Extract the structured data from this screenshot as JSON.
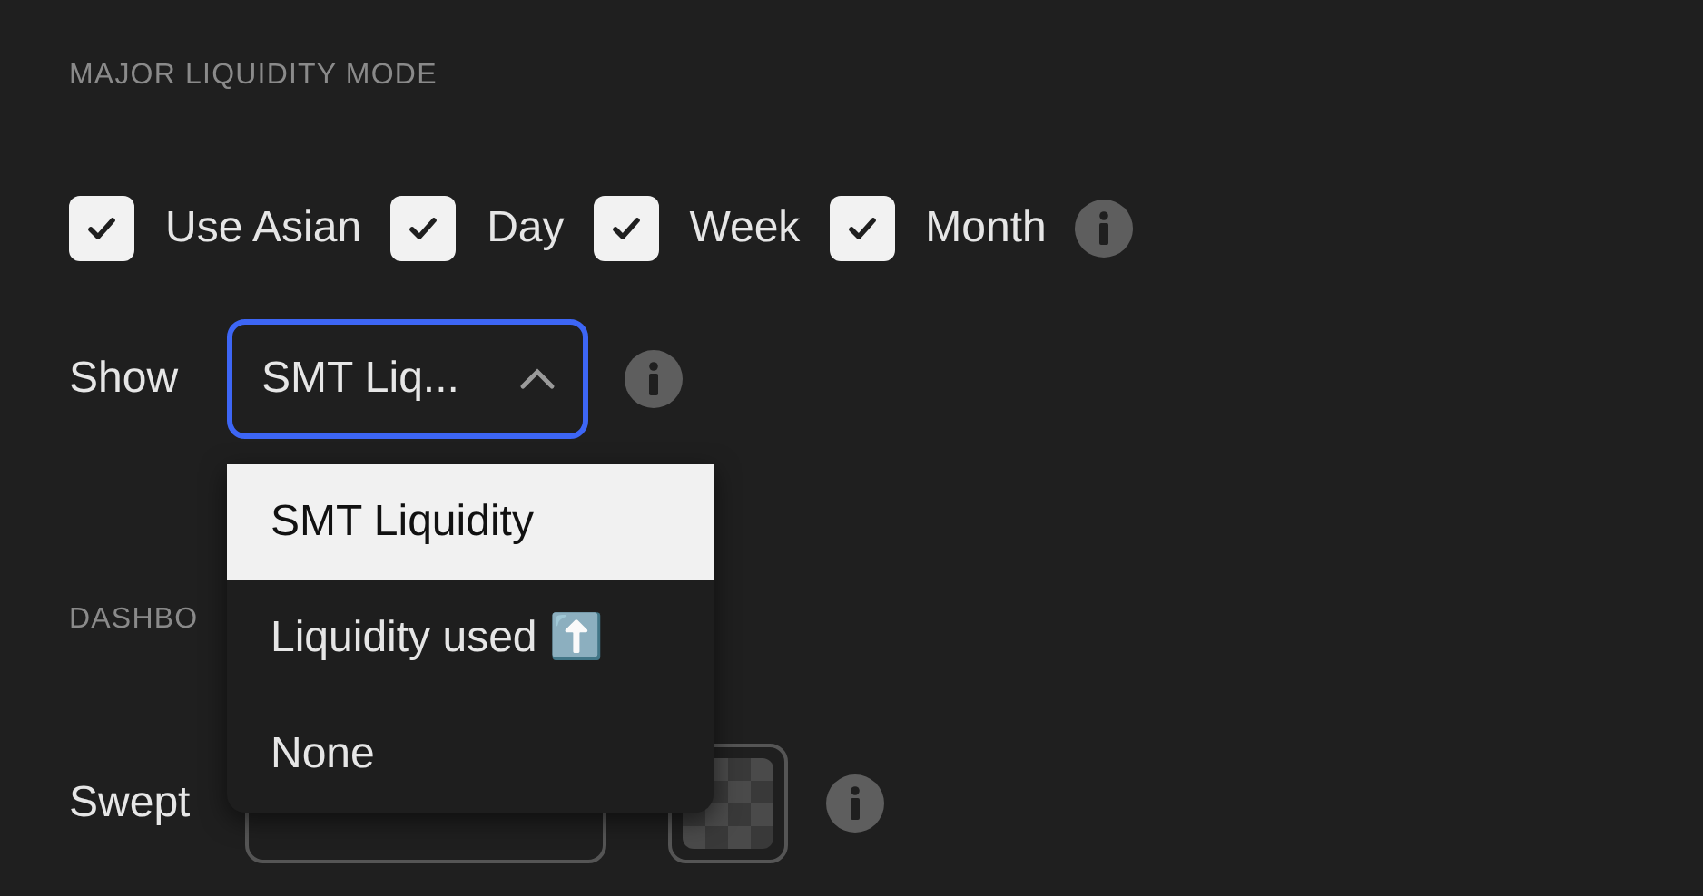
{
  "section": {
    "title": "MAJOR LIQUIDITY MODE"
  },
  "checkboxes": [
    {
      "label": "Use Asian",
      "checked": true
    },
    {
      "label": "Day",
      "checked": true
    },
    {
      "label": "Week",
      "checked": true
    },
    {
      "label": "Month",
      "checked": true
    }
  ],
  "show": {
    "label": "Show",
    "value": "SMT Liq...",
    "expanded": true
  },
  "dropdown": [
    {
      "label": "SMT Liquidity",
      "selected": true
    },
    {
      "label": "Liquidity used ⬆️",
      "selected": false
    },
    {
      "label": "None",
      "selected": false
    }
  ],
  "dashboard": {
    "title": "DASHBO"
  },
  "swept": {
    "label": "Swept"
  }
}
